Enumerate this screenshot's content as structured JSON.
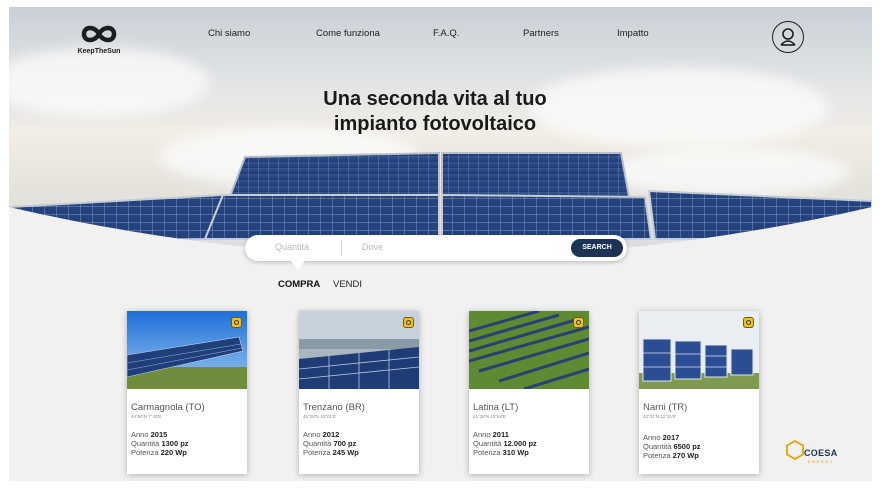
{
  "brand": {
    "name": "KeepTheSun"
  },
  "nav": {
    "items": [
      {
        "label": "Chi siamo"
      },
      {
        "label": "Come funziona"
      },
      {
        "label": "F.A.Q."
      },
      {
        "label": "Partners"
      },
      {
        "label": "Impatto"
      }
    ]
  },
  "hero": {
    "headline_line1": "Una seconda vita al tuo",
    "headline_line2": "impianto fotovoltaico"
  },
  "search": {
    "quantity_placeholder": "Quantità",
    "where_placeholder": "Dove",
    "button_label": "SEARCH"
  },
  "tabs": {
    "buy": "COMPRA",
    "sell": "VENDI"
  },
  "listings": [
    {
      "city": "Carmagnola (TO)",
      "coords": "44°50'N 7°43'E",
      "year_label": "Anno",
      "year": "2015",
      "qty_label": "Quantità",
      "qty": "1300 pz",
      "power_label": "Potenza",
      "power": "220 Wp"
    },
    {
      "city": "Trenzano (BR)",
      "coords": "45°28'N 10°01'E",
      "year_label": "Anno",
      "year": "2012",
      "qty_label": "Quantità",
      "qty": "700 pz",
      "power_label": "Potenza",
      "power": "245 Wp"
    },
    {
      "city": "Latina (LT)",
      "coords": "41°28'N 12°54'E",
      "year_label": "Anno",
      "year": "2011",
      "qty_label": "Quantità",
      "qty": "12.000 pz",
      "power_label": "Potenza",
      "power": "310 Wp"
    },
    {
      "city": "Narni (TR)",
      "coords": "42°31'N 12°31'E",
      "year_label": "Anno",
      "year": "2017",
      "qty_label": "Quantità",
      "qty": "6500 pz",
      "power_label": "Potenza",
      "power": "270 Wp"
    }
  ],
  "partner": {
    "name": "COESA",
    "sub": "ENERGY"
  },
  "colors": {
    "navy": "#1d3355",
    "badge_yellow": "#f1c40f",
    "partner_yellow": "#e0a500"
  }
}
